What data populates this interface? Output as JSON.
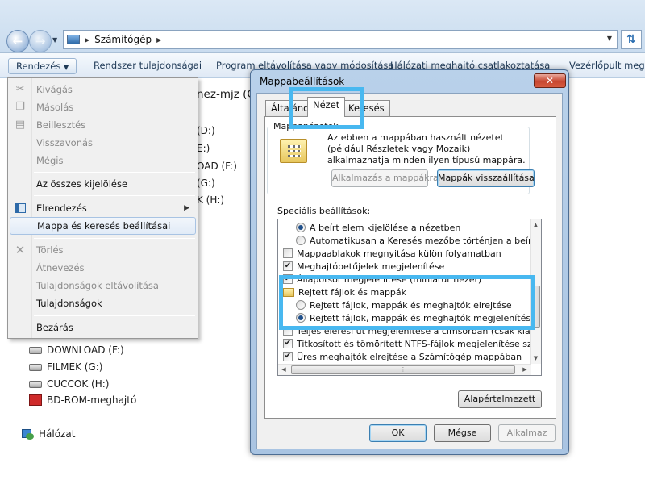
{
  "address": {
    "crumb": "Számítógép"
  },
  "toolbar": {
    "organize": "Rendezés",
    "items": [
      "Rendszer tulajdonságai",
      "Program eltávolítása vagy módosítása",
      "Hálózati meghajtó csatlakoztatása",
      "Vezérlőpult megn"
    ]
  },
  "menu": {
    "cut": "Kivágás",
    "copy": "Másolás",
    "paste": "Beillesztés",
    "undo": "Visszavonás",
    "redo": "Mégis",
    "select_all": "Az összes kijelölése",
    "layout": "Elrendezés",
    "folder_options": "Mappa és keresés beállításai",
    "delete": "Törlés",
    "rename": "Átnevezés",
    "remove_props": "Tulajdonságok eltávolítása",
    "properties": "Tulajdonságok",
    "close": "Bezárás"
  },
  "main_partial": [
    "nez-mjz (C:)",
    "(D:)",
    "E:)",
    "OAD (F:)",
    "(G:)",
    "K (H:)"
  ],
  "left_drives": [
    {
      "label": "DOWNLOAD (F:)",
      "icon": "drive-icon"
    },
    {
      "label": "FILMEK (G:)",
      "icon": "drive-icon"
    },
    {
      "label": "CUCCOK (H:)",
      "icon": "drive-icon"
    },
    {
      "label": "BD-ROM-meghajtó",
      "icon": "bd-rom-icon"
    }
  ],
  "network": "Hálózat",
  "dialog": {
    "title": "Mappabeállítások",
    "tabs": [
      "Általános",
      "Nézet",
      "Keresés"
    ],
    "active_tab": "Nézet",
    "folder_views_title": "Mappanézetek",
    "folder_views_desc": "Az ebben a mappában használt nézetet (például Részletek vagy Mozaik) alkalmazhatja minden ilyen típusú mappára.",
    "apply_btn": "Alkalmazás a mappákra",
    "reset_btn": "Mappák visszaállítása",
    "advanced_label": "Speciális beállítások:",
    "settings": [
      {
        "type": "radio",
        "indent": 1,
        "checked": true,
        "label": "A beírt elem kijelölése a nézetben"
      },
      {
        "type": "radio",
        "indent": 1,
        "checked": false,
        "label": "Automatikusan a Keresés mezőbe történjen a beírás"
      },
      {
        "type": "check",
        "indent": 0,
        "checked": false,
        "label": "Mappaablakok megnyitása külön folyamatban"
      },
      {
        "type": "check",
        "indent": 0,
        "checked": true,
        "label": "Meghajtóbetűjelek megjelenítése"
      },
      {
        "type": "check",
        "indent": 0,
        "checked": true,
        "label": "Állapotsor megjelenítése (miniatűr nézet)"
      },
      {
        "type": "folder",
        "indent": 0,
        "checked": false,
        "label": "Rejtett fájlok és mappák"
      },
      {
        "type": "radio",
        "indent": 1,
        "checked": false,
        "label": "Rejtett fájlok, mappák és meghajtók elrejtése"
      },
      {
        "type": "radio",
        "indent": 1,
        "checked": true,
        "label": "Rejtett fájlok, mappák és meghajtók megjelenítése"
      },
      {
        "type": "check",
        "indent": 0,
        "checked": false,
        "label": "Teljes elérési út megjelenítése a címsorban (csak klasszikus)"
      },
      {
        "type": "check",
        "indent": 0,
        "checked": true,
        "label": "Titkosított és tömörített NTFS-fájlok megjelenítése színekkel"
      },
      {
        "type": "check",
        "indent": 0,
        "checked": true,
        "label": "Üres meghajtók elrejtése a Számítógép mappában"
      }
    ],
    "defaults_btn": "Alapértelmezett",
    "ok": "OK",
    "cancel": "Mégse",
    "apply": "Alkalmaz"
  },
  "colors": {
    "highlight": "#48b8f0"
  }
}
